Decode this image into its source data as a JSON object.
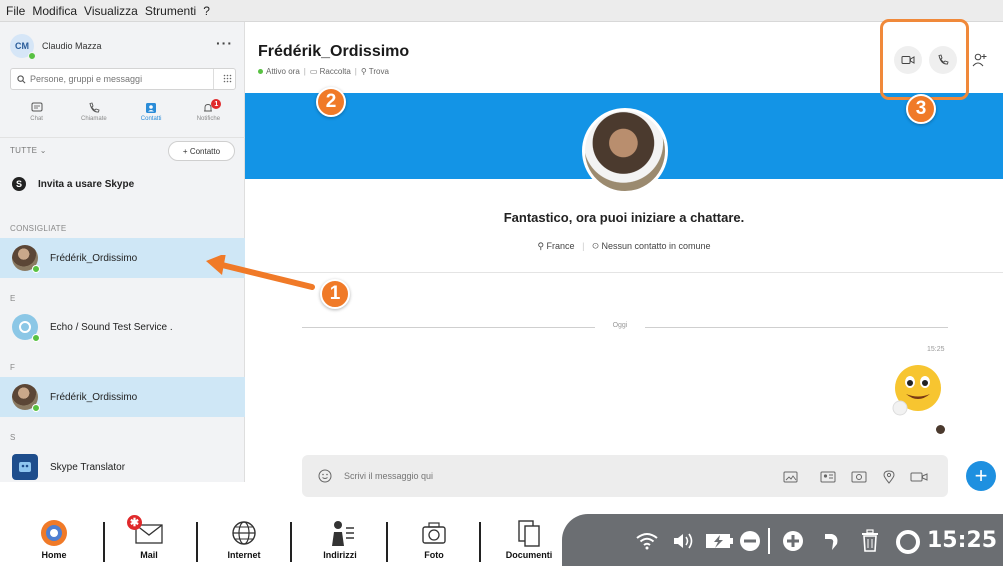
{
  "menu": [
    "File",
    "Modifica",
    "Visualizza",
    "Strumenti",
    "?"
  ],
  "profile": {
    "initials": "CM",
    "name": "Claudio Mazza"
  },
  "search": {
    "placeholder": "Persone, gruppi e messaggi"
  },
  "nav_tabs": [
    {
      "label": "Chat",
      "icon": "chat-icon"
    },
    {
      "label": "Chiamate",
      "icon": "phone-icon"
    },
    {
      "label": "Contatti",
      "icon": "contacts-icon",
      "active": true
    },
    {
      "label": "Notifiche",
      "icon": "bell-icon",
      "badge": "1"
    }
  ],
  "filter": {
    "label": "TUTTE",
    "add_contact": "+ Contatto"
  },
  "invite": "Invita a usare Skype",
  "sections": {
    "consigliate": "CONSIGLIATE",
    "e": "E",
    "f": "F",
    "s": "S"
  },
  "contacts": {
    "recommended": "Frédérik_Ordissimo",
    "echo": "Echo / Sound Test Service .",
    "fred": "Frédérik_Ordissimo",
    "translator": "Skype Translator"
  },
  "chat": {
    "name": "Frédérik_Ordissimo",
    "status": "Attivo ora",
    "gallery": "Raccolta",
    "find": "Trova",
    "headline": "Fantastico, ora puoi iniziare a chattare.",
    "location": "France",
    "mutual": "Nessun contatto in comune",
    "day": "Oggi",
    "time": "15:25",
    "composer_placeholder": "Scrivi il messaggio qui"
  },
  "annotations": [
    "1",
    "2",
    "3"
  ],
  "taskbar": {
    "items": [
      "Home",
      "Mail",
      "Internet",
      "Indirizzi",
      "Foto",
      "Documenti"
    ],
    "mail_badge": "✱",
    "clock": "15:25"
  },
  "colors": {
    "accent": "#1394e6",
    "highlight": "#f07a28",
    "online": "#58c142",
    "selected": "#cfe7f6"
  }
}
